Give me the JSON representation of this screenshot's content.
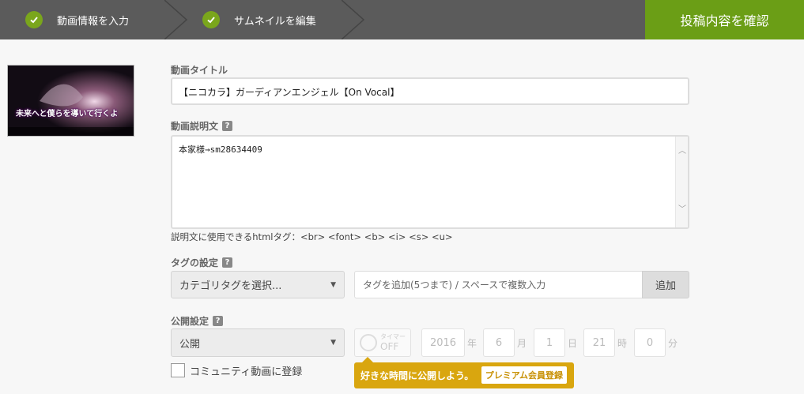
{
  "steps": {
    "step1_label": "動画情報を入力",
    "step2_label": "サムネイルを編集",
    "confirm_label": "投稿内容を確認"
  },
  "thumbnail": {
    "caption": "未来へと僕らを導いて行くよ"
  },
  "title": {
    "label": "動画タイトル",
    "value": "【ニコカラ】ガーディアンエンジェル【On Vocal】"
  },
  "description": {
    "label": "動画説明文",
    "value": "本家様→sm28634409",
    "hint": "説明文に使用できるhtmlタグ：<br> <font> <b> <i> <s> <u>"
  },
  "tags": {
    "label": "タグの設定",
    "category_select": "カテゴリタグを選択...",
    "input_placeholder": "タグを追加(5つまで) / スペースで複数入力",
    "add_button": "追加"
  },
  "publish": {
    "label": "公開設定",
    "visibility": "公開",
    "timer_label": "タイマー",
    "timer_state": "OFF",
    "year": "2016",
    "year_unit": "年",
    "month": "6",
    "month_unit": "月",
    "day": "1",
    "day_unit": "日",
    "hour": "21",
    "hour_unit": "時",
    "minute": "0",
    "minute_unit": "分",
    "community_label": "コミュニティ動画に登録",
    "premium_text": "好きな時間に公開しよう。",
    "premium_button": "プレミアム会員登録"
  },
  "colors": {
    "stepbar": "#5b5b5b",
    "active_step": "#6b9e16",
    "check": "#7aa61c",
    "premium": "#d9a60f"
  }
}
